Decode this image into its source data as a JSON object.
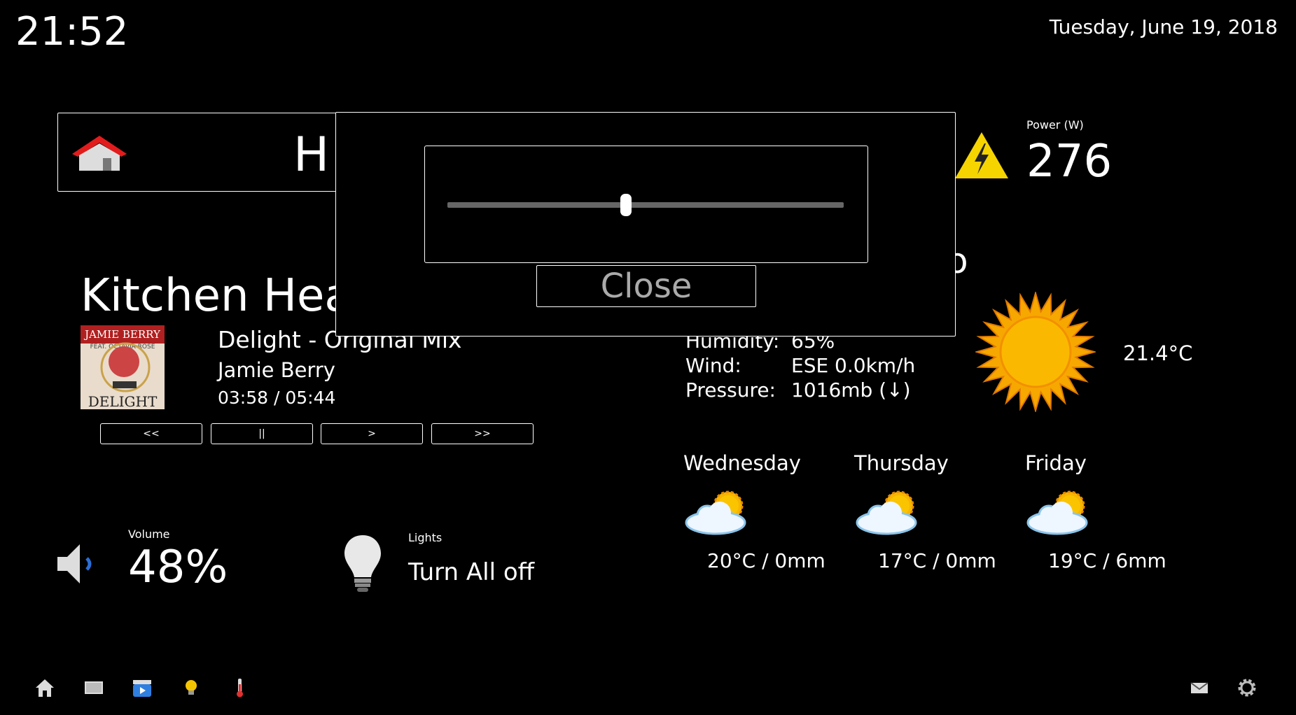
{
  "header": {
    "time": "21:52",
    "date": "Tuesday, June 19, 2018"
  },
  "home": {
    "title": "H",
    "icon": "house-icon"
  },
  "power": {
    "label": "Power (W)",
    "value": "276",
    "icon": "lightning-warning-icon"
  },
  "media": {
    "room": "Kitchen Hea",
    "track": "Delight - Original Mix",
    "artist": "Jamie Berry",
    "time": "03:58 / 05:44",
    "album_art": {
      "line1": "JAMIE BERRY",
      "line2": "FEAT. OCTAVIA ROSE",
      "line3": "DELIGHT"
    },
    "buttons": {
      "prev": "<<",
      "pause": "||",
      "play": ">",
      "next": ">>"
    }
  },
  "weather": {
    "partial_heading": "o",
    "humidity_label": "Humidity:",
    "humidity": "65%",
    "wind_label": "Wind:",
    "wind": "ESE 0.0km/h",
    "pressure_label": "Pressure:",
    "pressure": "1016mb (↓)",
    "current_temp": "21.4°C",
    "current_icon": "sun-icon",
    "forecast": [
      {
        "day": "Wednesday",
        "value": "20°C / 0mm",
        "icon": "partly-cloudy-icon"
      },
      {
        "day": "Thursday",
        "value": "17°C / 0mm",
        "icon": "partly-cloudy-icon"
      },
      {
        "day": "Friday",
        "value": "19°C / 6mm",
        "icon": "partly-cloudy-icon"
      }
    ]
  },
  "volume": {
    "label": "Volume",
    "value": "48%",
    "icon": "speaker-icon"
  },
  "lights": {
    "label": "Lights",
    "button": "Turn All off",
    "icon": "lightbulb-icon"
  },
  "dialog": {
    "slider_value": 0.45,
    "close_label": "Close"
  },
  "nav": {
    "left": [
      "home-icon",
      "tv-icon",
      "movie-icon",
      "lightbulb-icon",
      "thermometer-icon"
    ],
    "right": [
      "mail-icon",
      "gear-icon"
    ]
  },
  "colors": {
    "background": "#000000",
    "accent_red": "#e03030",
    "sun": "#f7a800"
  }
}
